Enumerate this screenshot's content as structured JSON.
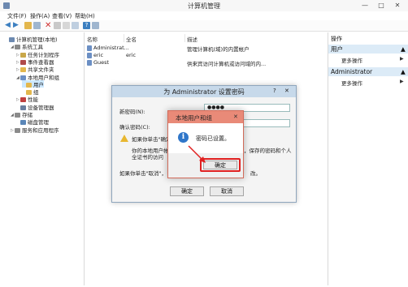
{
  "window": {
    "title": "计算机管理",
    "controls": [
      "—",
      "□",
      "✕"
    ]
  },
  "menu": [
    "文件(F)",
    "操作(A)",
    "查看(V)",
    "帮助(H)"
  ],
  "tree": [
    {
      "label": "计算机管理(本地)",
      "indent": 0,
      "icon": "computer-icon",
      "color": "#6c89b0",
      "expand": ""
    },
    {
      "label": "系统工具",
      "indent": 1,
      "icon": "tools-icon",
      "color": "#8b8b8b",
      "expand": "◢"
    },
    {
      "label": "任务计划程序",
      "indent": 2,
      "icon": "clock-icon",
      "color": "#c9a84a",
      "expand": "▷"
    },
    {
      "label": "事件查看器",
      "indent": 2,
      "icon": "event-icon",
      "color": "#b04a4a",
      "expand": "▷"
    },
    {
      "label": "共享文件夹",
      "indent": 2,
      "icon": "folder-icon",
      "color": "#e3b74d",
      "expand": "▷"
    },
    {
      "label": "本地用户和组",
      "indent": 2,
      "icon": "users-icon",
      "color": "#6b8fc4",
      "expand": "◢"
    },
    {
      "label": "用户",
      "indent": 3,
      "icon": "folder-icon",
      "color": "#e3b74d",
      "expand": ""
    },
    {
      "label": "组",
      "indent": 3,
      "icon": "folder-icon",
      "color": "#e3b74d",
      "expand": ""
    },
    {
      "label": "性能",
      "indent": 2,
      "icon": "performance-icon",
      "color": "#c04040",
      "expand": "▷"
    },
    {
      "label": "设备管理器",
      "indent": 2,
      "icon": "device-icon",
      "color": "#6a7fa0",
      "expand": ""
    },
    {
      "label": "存储",
      "indent": 1,
      "icon": "storage-icon",
      "color": "#8b8b8b",
      "expand": "◢"
    },
    {
      "label": "磁盘管理",
      "indent": 2,
      "icon": "disk-icon",
      "color": "#5a86b8",
      "expand": ""
    },
    {
      "label": "服务和应用程序",
      "indent": 1,
      "icon": "services-icon",
      "color": "#8b8b8b",
      "expand": "▷"
    }
  ],
  "list": {
    "columns": [
      "名称",
      "全名",
      "描述"
    ],
    "rows": [
      {
        "name": "Administrat...",
        "full": "",
        "desc": "管理计算机(域)的内置帐户"
      },
      {
        "name": "eric",
        "full": "eric",
        "desc": ""
      },
      {
        "name": "Guest",
        "full": "",
        "desc": "供来宾访问计算机或访问域的内..."
      }
    ]
  },
  "actions": {
    "header": "操作",
    "sections": [
      {
        "title": "用户",
        "item": "更多操作"
      },
      {
        "title": "Administrator",
        "item": "更多操作"
      }
    ]
  },
  "pwd_dialog": {
    "title": "为 Administrator 设置密码",
    "new_pwd_label": "新密码(N):",
    "new_pwd_value": "●●●●",
    "confirm_label": "确认密码(C):",
    "warning_line1": "如果你单击\"确定",
    "warning_line2": "你的本地用户帐",
    "warning_line3": "全证书的访问",
    "warning_right": "，保存的密码和个人",
    "cancel_note_left": "如果你单击\"取消\"，",
    "cancel_note_right": "改。",
    "ok": "确定",
    "cancel": "取消"
  },
  "msgbox": {
    "title": "本地用户和组",
    "message": "密码已设置。",
    "ok": "确定"
  }
}
